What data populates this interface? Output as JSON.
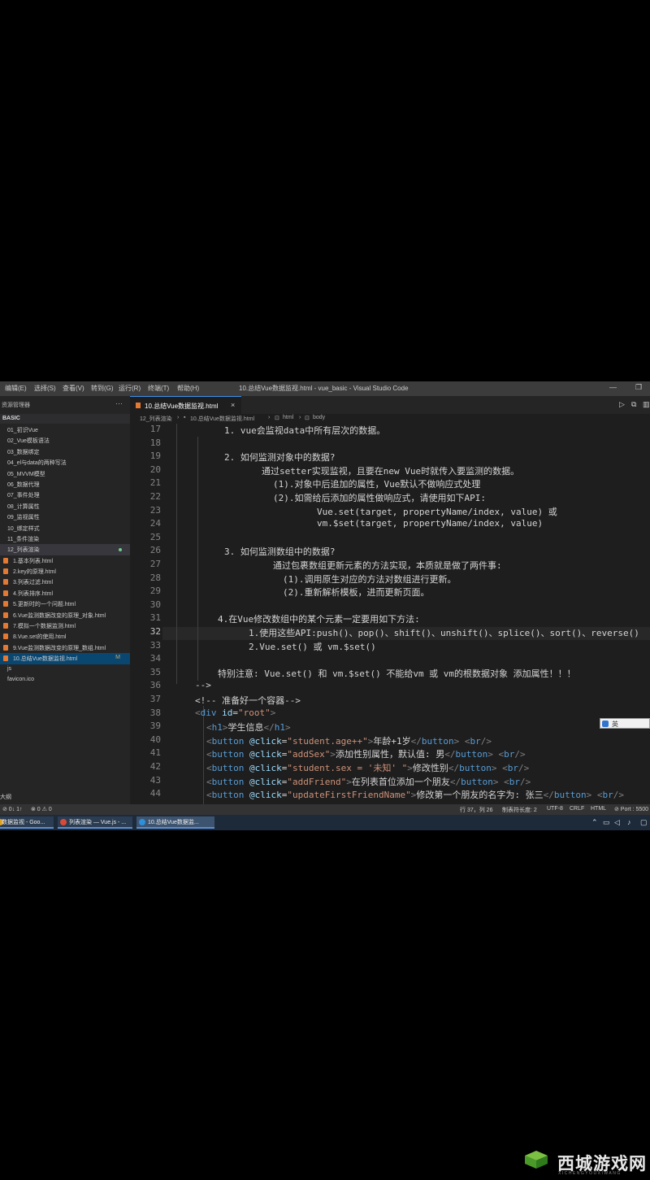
{
  "menubar": {
    "items": [
      "编辑(E)",
      "选择(S)",
      "查看(V)",
      "转到(G)",
      "运行(R)",
      "终端(T)",
      "帮助(H)"
    ],
    "window_title": "10.总结Vue数据监视.html - vue_basic - Visual Studio Code"
  },
  "sidebar": {
    "title": "资源管理器",
    "project": "BASIC",
    "items": [
      {
        "label": "01_初识Vue",
        "type": "folder"
      },
      {
        "label": "02_Vue模板语法",
        "type": "folder"
      },
      {
        "label": "03_数据绑定",
        "type": "folder"
      },
      {
        "label": "04_el与data的两种写法",
        "type": "folder"
      },
      {
        "label": "05_MVVM模型",
        "type": "folder"
      },
      {
        "label": "06_数据代理",
        "type": "folder"
      },
      {
        "label": "07_事件处理",
        "type": "folder"
      },
      {
        "label": "08_计算属性",
        "type": "folder"
      },
      {
        "label": "09_监视属性",
        "type": "folder"
      },
      {
        "label": "10_绑定样式",
        "type": "folder"
      },
      {
        "label": "11_条件渲染",
        "type": "folder"
      },
      {
        "label": "12_列表渲染",
        "type": "folder",
        "selected": true
      },
      {
        "label": "1.基本列表.html",
        "type": "file"
      },
      {
        "label": "2.key的原理.html",
        "type": "file"
      },
      {
        "label": "3.列表过滤.html",
        "type": "file"
      },
      {
        "label": "4.列表排序.html",
        "type": "file"
      },
      {
        "label": "5.更新时的一个问题.html",
        "type": "file"
      },
      {
        "label": "6.Vue监测数据改变的原理_对象.html",
        "type": "file"
      },
      {
        "label": "7.模拟一个数据监测.html",
        "type": "file"
      },
      {
        "label": "8.Vue.set的使用.html",
        "type": "file"
      },
      {
        "label": "9.Vue监测数据改变的原理_数组.html",
        "type": "file"
      },
      {
        "label": "10.总结Vue数据监视.html",
        "type": "file",
        "active": true,
        "badge": "M"
      },
      {
        "label": "js",
        "type": "folder"
      },
      {
        "label": "favicon.ico",
        "type": "folder"
      }
    ],
    "outline": "大纲"
  },
  "tabs": {
    "active": "10.总结Vue数据监视.html",
    "active_badge": "M"
  },
  "breadcrumb": [
    "12_列表渲染",
    "10.总结Vue数据监视.html",
    "html",
    "body"
  ],
  "editor": {
    "lines": [
      {
        "n": "17",
        "text": "1. vue会监视data中所有层次的数据。"
      },
      {
        "n": "18",
        "text": ""
      },
      {
        "n": "19",
        "text": "2. 如何监测对象中的数据?"
      },
      {
        "n": "20",
        "text": "通过setter实现监视，且要在new Vue时就传入要监测的数据。"
      },
      {
        "n": "21",
        "text": "(1).对象中后追加的属性，Vue默认不做响应式处理"
      },
      {
        "n": "22",
        "text": "(2).如需给后添加的属性做响应式，请使用如下API:"
      },
      {
        "n": "23",
        "text": "Vue.set(target, propertyName/index, value) 或"
      },
      {
        "n": "24",
        "text": "vm.$set(target, propertyName/index, value)"
      },
      {
        "n": "25",
        "text": ""
      },
      {
        "n": "26",
        "text": "3. 如何监测数组中的数据?"
      },
      {
        "n": "27",
        "text": "通过包裹数组更新元素的方法实现，本质就是做了两件事:"
      },
      {
        "n": "28",
        "text": "(1).调用原生对应的方法对数组进行更新。"
      },
      {
        "n": "29",
        "text": "(2).重新解析模板，进而更新页面。"
      },
      {
        "n": "30",
        "text": ""
      },
      {
        "n": "31",
        "text": "4.在Vue修改数组中的某个元素一定要用如下方法:"
      },
      {
        "n": "32",
        "text": "1.使用这些API:push()、pop()、shift()、unshift()、splice()、sort()、reverse()"
      },
      {
        "n": "33",
        "text": "2.Vue.set() 或 vm.$set()"
      },
      {
        "n": "34",
        "text": ""
      },
      {
        "n": "35",
        "text": "特别注意: Vue.set() 和 vm.$set() 不能给vm 或 vm的根数据对象 添加属性！！！"
      },
      {
        "n": "36",
        "text": "-->"
      },
      {
        "n": "37",
        "text": "<!-- 准备好一个容器-->"
      },
      {
        "n": "38",
        "text": "<div id=\"root\">"
      },
      {
        "n": "39",
        "text": "<h1>学生信息</h1>"
      },
      {
        "n": "40",
        "text": "<button @click=\"student.age++\">年龄+1岁</button> <br/>"
      },
      {
        "n": "41",
        "text": "<button @click=\"addSex\">添加性别属性，默认值: 男</button> <br/>"
      },
      {
        "n": "42",
        "text": "<button @click=\"student.sex = '未知' \">修改性别</button> <br/>"
      },
      {
        "n": "43",
        "text": "<button @click=\"addFriend\">在列表首位添加一个朋友</button> <br/>"
      },
      {
        "n": "44",
        "text": "<button @click=\"updateFirstFriendName\">修改第一个朋友的名字为: 张三</button> <br/>"
      }
    ],
    "current_line": "32"
  },
  "ime": {
    "label": "英"
  },
  "statusbar": {
    "left": [
      "⊘ 0↓ 1↑",
      "⊗ 0 ⚠ 0"
    ],
    "right": [
      "行 37，列 26",
      "制表符长度: 2",
      "UTF-8",
      "CRLF",
      "HTML",
      "⊘ Port : 5500"
    ]
  },
  "taskbar": {
    "items": [
      "数据监视 - Goo...",
      "列表渲染 — Vue.js - ...",
      "10.总结Vue数据监..."
    ]
  },
  "watermark": {
    "text": "西城游戏网",
    "sub": "XICHENGYOUXIWANG"
  },
  "colors": {
    "accent": "#3b8eea",
    "editor_bg": "#1e1e1e",
    "sidebar_bg": "#252526",
    "statusbar": "#333333"
  }
}
